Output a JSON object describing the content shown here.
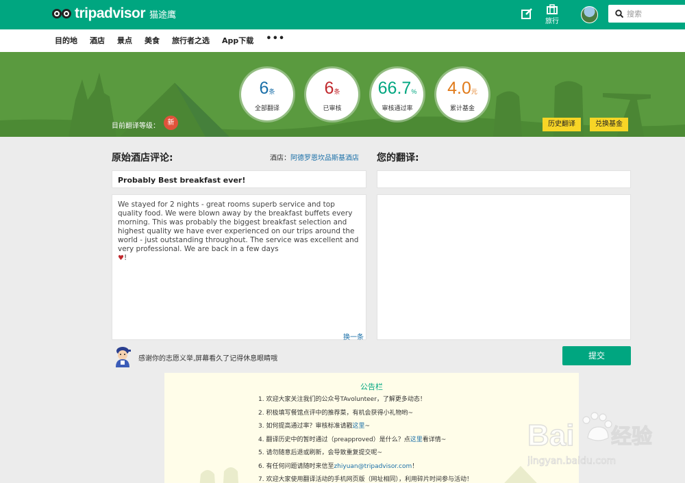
{
  "header": {
    "logo_text": "tripadvisor",
    "logo_cn": "猫途鹰",
    "trip_label": "旅行",
    "search_placeholder": "搜索"
  },
  "nav": {
    "items": [
      "目的地",
      "酒店",
      "景点",
      "美食",
      "旅行者之选",
      "App下载"
    ],
    "more": "•••"
  },
  "banner": {
    "stats": [
      {
        "value": "6",
        "unit": "条",
        "label": "全部翻译",
        "color": "#1a6fa8"
      },
      {
        "value": "6",
        "unit": "条",
        "label": "已审核",
        "color": "#c0282d"
      },
      {
        "value": "66.7",
        "unit": "%",
        "label": "审核通过率",
        "color": "#00a680"
      },
      {
        "value": "4.0",
        "unit": "元",
        "label": "累计基金",
        "color": "#e07a1a"
      }
    ],
    "level_label": "目前翻译等级：",
    "level_badge": "新",
    "history_button": "历史翻译",
    "exchange_button": "兑换基金"
  },
  "original": {
    "heading": "原始酒店评论:",
    "hotel_label": "酒店：",
    "hotel_name": "阿德罗恩坎品斯基酒店",
    "title": "Probably Best breakfast ever!",
    "body": "We stayed for 2 nights - great rooms superb service and top quality food. We were blown away by the breakfast buffets every morning. This was probably the biggest breakfast selection and highest quality we have ever experienced on our trips around the world - just outstanding throughout. The service was excellent and very professional. We are back in a few days",
    "body_end": "!",
    "swap": "换一条"
  },
  "translation": {
    "heading": "您的翻译:"
  },
  "footer": {
    "thanks": "感谢你的志愿义举,屏幕看久了记得休息眼睛哦",
    "submit": "提交"
  },
  "notice": {
    "title": "公告栏",
    "items": [
      {
        "pre": "1. 欢迎大家关注我们的公众号TAvolunteer，了解更多动态！",
        "link": "",
        "post": ""
      },
      {
        "pre": "2. 积极填写餐馆点评中的推荐菜，有机会获得小礼物哟~",
        "link": "",
        "post": ""
      },
      {
        "pre": "3. 如何提高通过率？审核标准请戳",
        "link": "这里",
        "post": "~"
      },
      {
        "pre": "4. 翻译历史中的暂时通过（preapproved）是什么？点",
        "link": "这里",
        "post": "看详情~"
      },
      {
        "pre": "5. 请勿随意后退或刷新，会导致重复提交呢~",
        "link": "",
        "post": ""
      },
      {
        "pre": "6. 有任何问题请随时来信至",
        "link": "zhiyuan@tripadvisor.com",
        "post": "！"
      },
      {
        "pre": "7. 欢迎大家使用翻译活动的手机网页版（网址相同），利用碎片时间参与活动！",
        "link": "",
        "post": ""
      }
    ]
  },
  "watermark": {
    "brand": "Bai",
    "brand2": "经验",
    "url": "jingyan.baidu.com"
  },
  "colors": {
    "brand": "#00a680",
    "banner": "#5a9a3f",
    "button_yellow": "#f7d526",
    "link": "#1a6fa8"
  }
}
